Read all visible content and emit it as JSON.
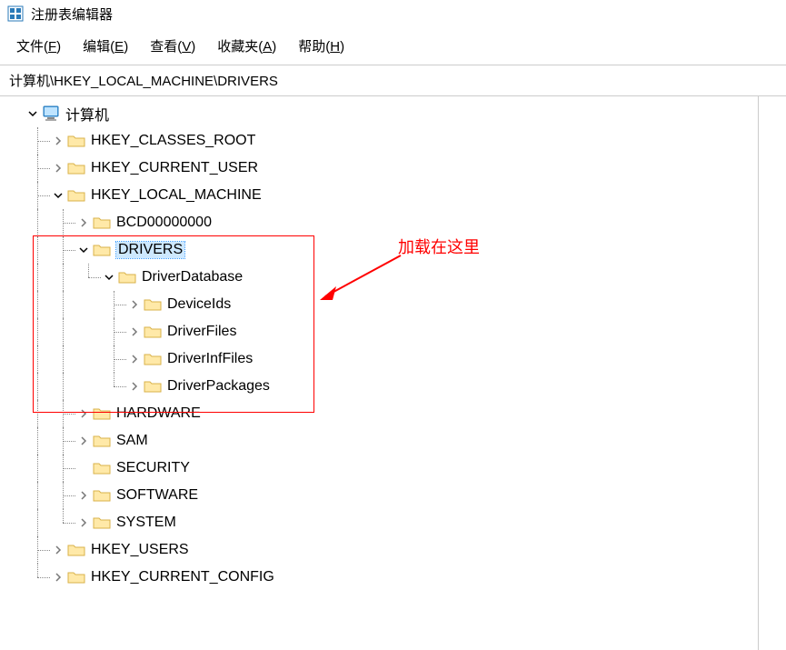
{
  "window": {
    "title": "注册表编辑器"
  },
  "menu": {
    "file": "文件(F)",
    "edit": "编辑(E)",
    "view": "查看(V)",
    "favorites": "收藏夹(A)",
    "help": "帮助(H)"
  },
  "address": "计算机\\HKEY_LOCAL_MACHINE\\DRIVERS",
  "tree": {
    "root": "计算机",
    "hkcr": "HKEY_CLASSES_ROOT",
    "hkcu": "HKEY_CURRENT_USER",
    "hklm": "HKEY_LOCAL_MACHINE",
    "bcd": "BCD00000000",
    "drivers": "DRIVERS",
    "driverdb": "DriverDatabase",
    "deviceids": "DeviceIds",
    "driverfiles": "DriverFiles",
    "driverinffiles": "DriverInfFiles",
    "driverpackages": "DriverPackages",
    "hardware": "HARDWARE",
    "sam": "SAM",
    "security": "SECURITY",
    "software": "SOFTWARE",
    "system": "SYSTEM",
    "hku": "HKEY_USERS",
    "hkcc": "HKEY_CURRENT_CONFIG"
  },
  "annotation": {
    "text": "加载在这里"
  }
}
